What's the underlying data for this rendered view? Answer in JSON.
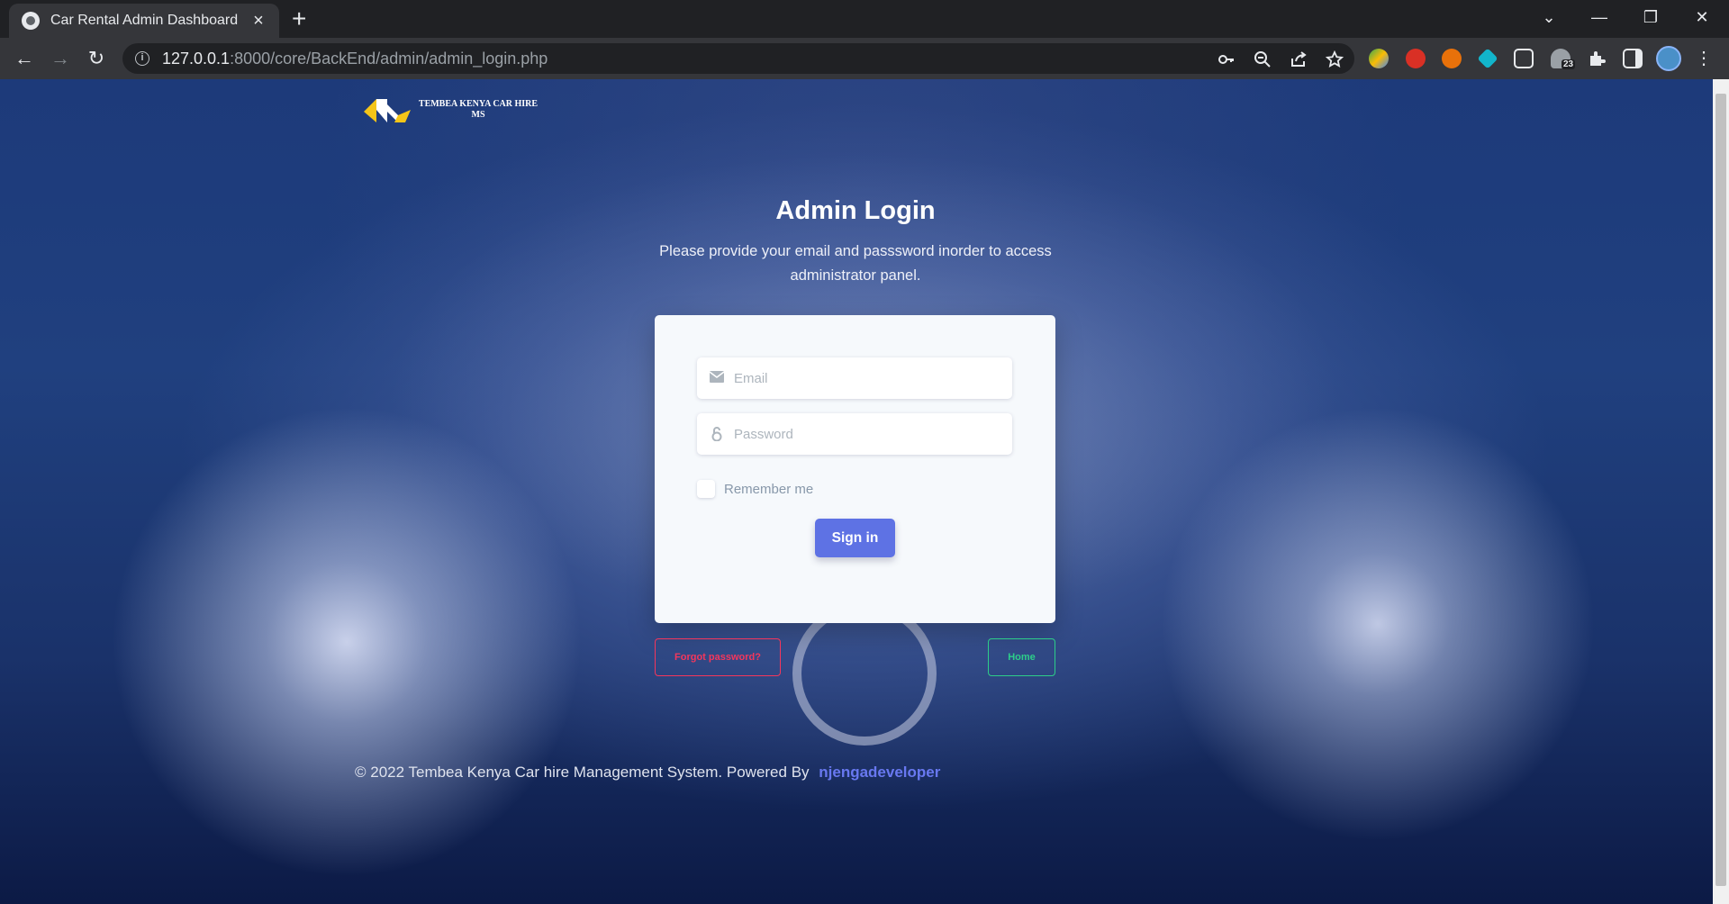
{
  "browser": {
    "tab_title": "Car Rental Admin Dashboard",
    "tab_close": "×",
    "new_tab": "+",
    "url_host": "127.0.0.1",
    "url_rest": ":8000/core/BackEnd/admin/admin_login.php",
    "extension_badge": "23",
    "window_controls": {
      "dropdown": "⌄",
      "minimize": "—",
      "restore": "❐",
      "close": "✕"
    },
    "nav": {
      "back": "←",
      "forward": "→",
      "reload": "↻"
    },
    "menu": "⋮"
  },
  "page": {
    "logo_text": "TEMBEA KENYA CAR HIRE MS",
    "heading": "Admin Login",
    "subtext": "Please provide your email and passsword inorder to access administrator panel.",
    "form": {
      "email_placeholder": "Email",
      "password_placeholder": "Password",
      "remember_label": "Remember me",
      "signin_label": "Sign in"
    },
    "forgot_label": "Forgot password?",
    "home_label": "Home",
    "footer_text": "© 2022 Tembea Kenya Car hire Management System. Powered By",
    "footer_link": "njengadeveloper"
  },
  "colors": {
    "primary": "#5e72e4",
    "danger": "#f5365c",
    "success": "#2dce89",
    "link": "#6878f0"
  }
}
